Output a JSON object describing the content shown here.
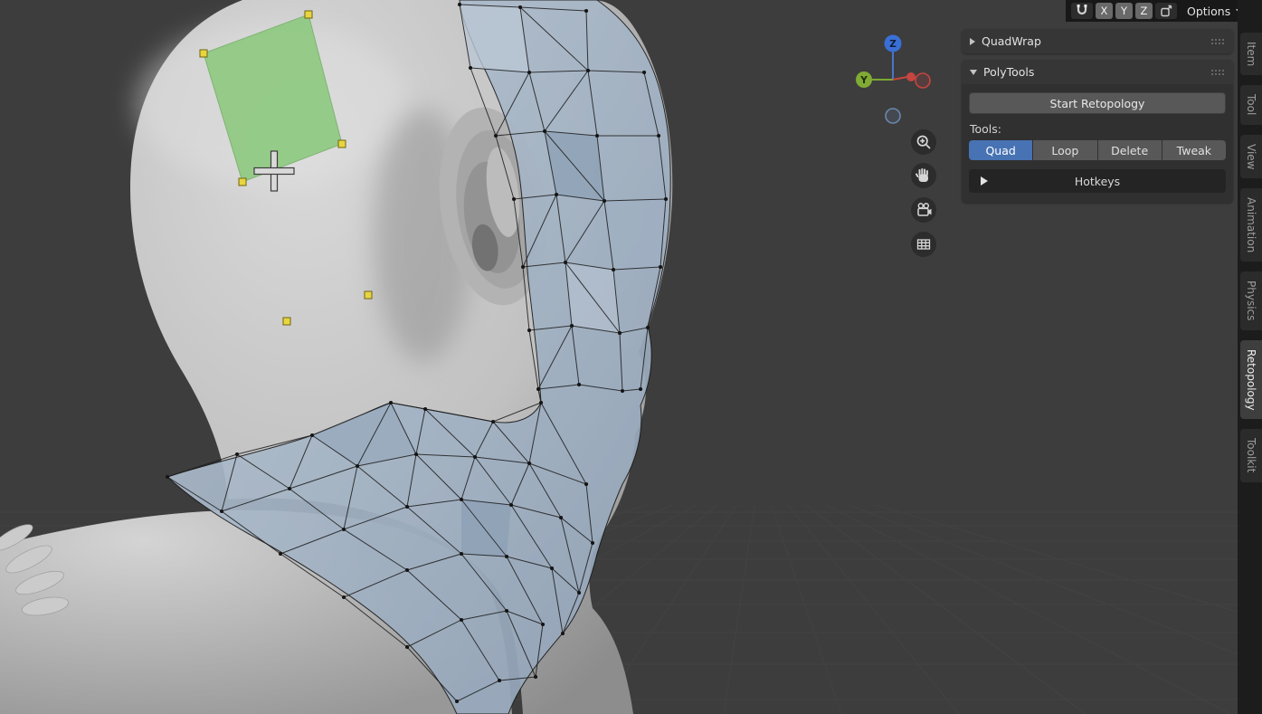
{
  "header": {
    "axes": [
      "X",
      "Y",
      "Z"
    ],
    "options_label": "Options"
  },
  "sidebar": {
    "quadwrap": {
      "title": "QuadWrap"
    },
    "polytools": {
      "title": "PolyTools",
      "start_button": "Start Retopology",
      "tools_label": "Tools:",
      "tools": [
        {
          "label": "Quad",
          "active": true
        },
        {
          "label": "Loop",
          "active": false
        },
        {
          "label": "Delete",
          "active": false
        },
        {
          "label": "Tweak",
          "active": false
        }
      ],
      "hotkeys_label": "Hotkeys"
    }
  },
  "tabs": [
    {
      "label": "Item",
      "active": false
    },
    {
      "label": "Tool",
      "active": false
    },
    {
      "label": "View",
      "active": false
    },
    {
      "label": "Animation",
      "active": false
    },
    {
      "label": "Physics",
      "active": false
    },
    {
      "label": "Retopology",
      "active": true
    },
    {
      "label": "Toolkit",
      "active": false
    }
  ],
  "viewport": {
    "gizmo": {
      "z_label": "Z",
      "y_label": "Y"
    }
  },
  "colors": {
    "accent_blue": "#4772b3",
    "vertex_yellow": "#e8d53f",
    "quad_green": "#8cc97e",
    "axis_x": "#c64540",
    "axis_y": "#81ab34",
    "axis_z": "#3a6fd6"
  }
}
